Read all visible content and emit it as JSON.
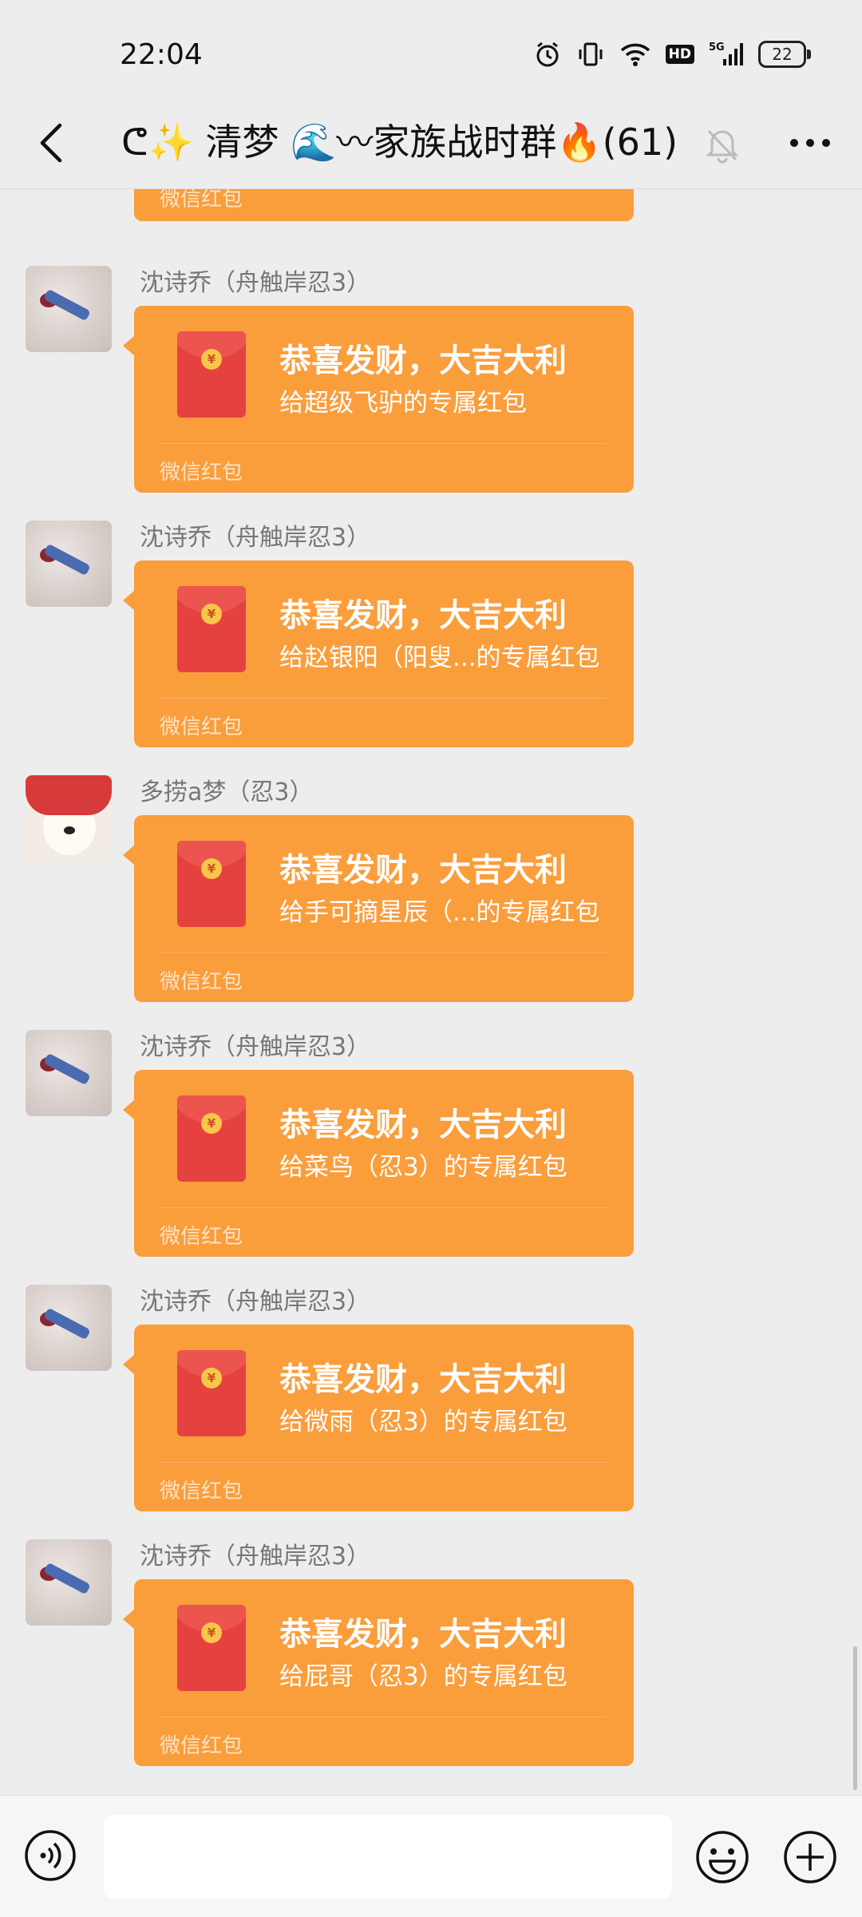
{
  "status": {
    "time": "22:04",
    "battery": "22",
    "hd": "HD",
    "network": "5G"
  },
  "header": {
    "title": "ᕦ✨ 清梦 🌊〰家族战时群🔥(61)"
  },
  "chat": {
    "partial_label": "微信红包",
    "messages": [
      {
        "sender": "沈诗乔（舟触岸忍3）",
        "title": "恭喜发财，大吉大利",
        "desc": "给超级飞驴的专属红包",
        "label": "微信红包"
      },
      {
        "sender": "沈诗乔（舟触岸忍3）",
        "title": "恭喜发财，大吉大利",
        "desc": "给赵银阳（阳叟...的专属红包",
        "label": "微信红包"
      },
      {
        "sender": "多捞a梦（忍3）",
        "title": "恭喜发财，大吉大利",
        "desc": "给手可摘星辰（...的专属红包",
        "label": "微信红包"
      },
      {
        "sender": "沈诗乔（舟触岸忍3）",
        "title": "恭喜发财，大吉大利",
        "desc": "给菜鸟（忍3）的专属红包",
        "label": "微信红包"
      },
      {
        "sender": "沈诗乔（舟触岸忍3）",
        "title": "恭喜发财，大吉大利",
        "desc": "给微雨（忍3）的专属红包",
        "label": "微信红包"
      },
      {
        "sender": "沈诗乔（舟触岸忍3）",
        "title": "恭喜发财，大吉大利",
        "desc": "给屁哥（忍3）的专属红包",
        "label": "微信红包"
      }
    ]
  },
  "input": {
    "value": "",
    "placeholder": ""
  },
  "icons": {
    "back": "chevron-left-icon",
    "mute": "bell-off-icon",
    "more": "more-dots-icon",
    "voice": "voice-icon",
    "emoji": "emoji-icon",
    "plus": "plus-icon",
    "envelope": "red-envelope-icon",
    "coin": "yuan-icon"
  },
  "colors": {
    "bubble": "#fa9d3b",
    "envelope": "#e5423f",
    "background": "#ededed"
  }
}
